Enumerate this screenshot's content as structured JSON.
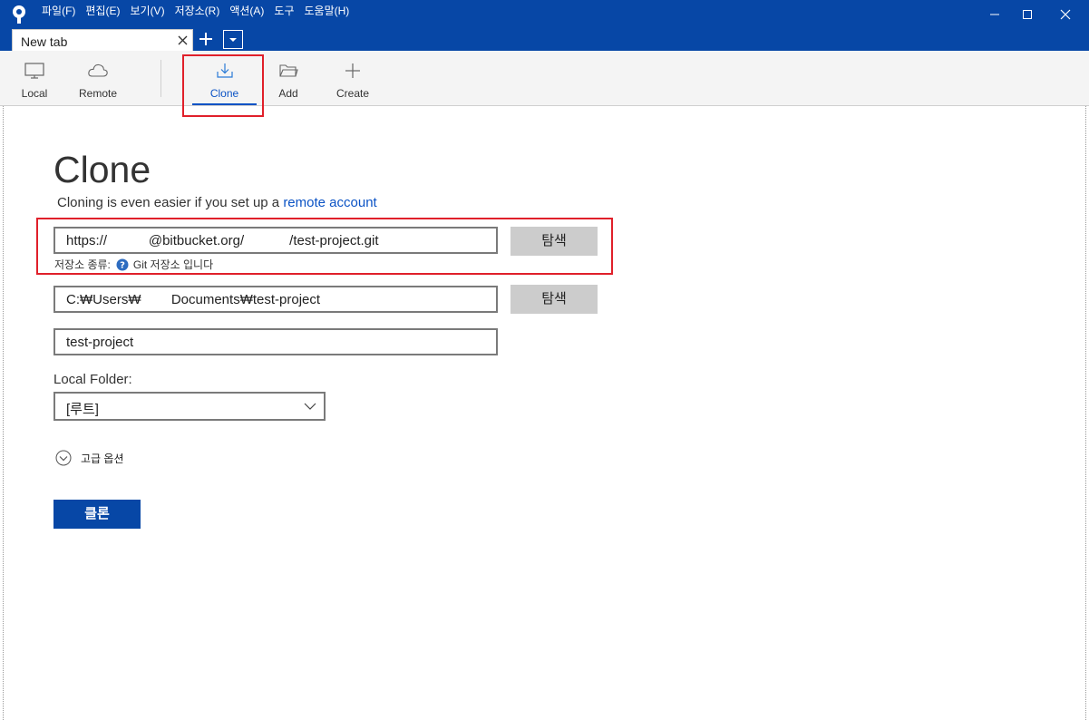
{
  "menu": [
    "파일(F)",
    "편집(E)",
    "보기(V)",
    "저장소(R)",
    "액션(A)",
    "도구",
    "도움말(H)"
  ],
  "icons": {
    "app": "sourcetree-logo-icon",
    "minimize": "minimize-icon",
    "maximize": "maximize-icon",
    "close": "close-icon",
    "tab_close": "close-icon",
    "new_tab": "plus-icon",
    "tab_menu": "chevron-down-icon",
    "local": "monitor-icon",
    "remote": "cloud-icon",
    "clone": "download-icon",
    "add": "folder-icon",
    "create": "plus-icon",
    "help": "question-circle-icon",
    "expand": "chevron-down-circle-icon",
    "select": "chevron-down-icon"
  },
  "tab": {
    "label": "New tab"
  },
  "toolbar": {
    "local": "Local",
    "remote": "Remote",
    "clone": "Clone",
    "add": "Add",
    "create": "Create",
    "active": "Clone"
  },
  "main": {
    "title": "Clone",
    "subtitle_prefix": "Cloning is even easier if you set up a ",
    "subtitle_link": "remote account",
    "source_url": "https://           @bitbucket.org/            /test-project.git",
    "browse_label": "탐색",
    "repo_type_label": "저장소 종류:",
    "repo_type_value": "Git 저장소 입니다",
    "destination_path": "C:₩Users₩        Documents₩test-project",
    "name": "test-project",
    "local_folder_label": "Local Folder:",
    "local_folder_value": "[루트]",
    "advanced_label": "고급 옵션",
    "clone_button": "클론"
  },
  "colors": {
    "titlebar": "#0747a6",
    "accent": "#0b53c5",
    "highlight": "#e0202a",
    "button_gray": "#cccccc"
  }
}
